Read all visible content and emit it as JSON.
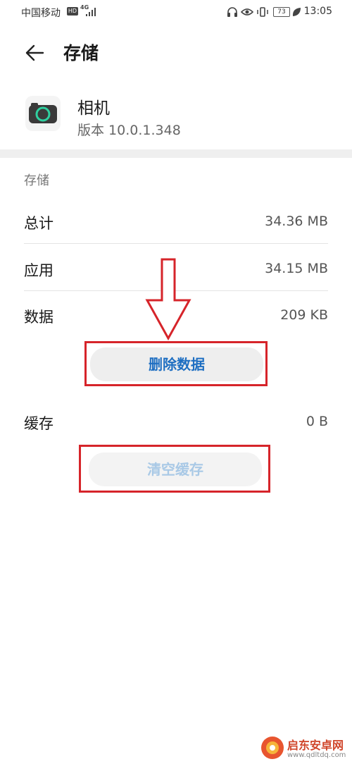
{
  "status_bar": {
    "carrier": "中国移动",
    "hd": "HD",
    "network": "4G",
    "battery": "73",
    "time": "13:05"
  },
  "header": {
    "title": "存储"
  },
  "app": {
    "name": "相机",
    "version": "版本 10.0.1.348"
  },
  "storage": {
    "section_title": "存储",
    "rows": [
      {
        "label": "总计",
        "value": "34.36 MB"
      },
      {
        "label": "应用",
        "value": "34.15 MB"
      },
      {
        "label": "数据",
        "value": "209 KB"
      }
    ],
    "delete_button": "删除数据",
    "cache": {
      "label": "缓存",
      "value": "0 B"
    },
    "clear_button": "清空缓存"
  },
  "watermark": {
    "name": "启东安卓网",
    "url": "www.qdltdq.com"
  },
  "colors": {
    "accent": "#1f6fc2",
    "highlight": "#d6242a",
    "disabled": "#a9c9e6"
  }
}
